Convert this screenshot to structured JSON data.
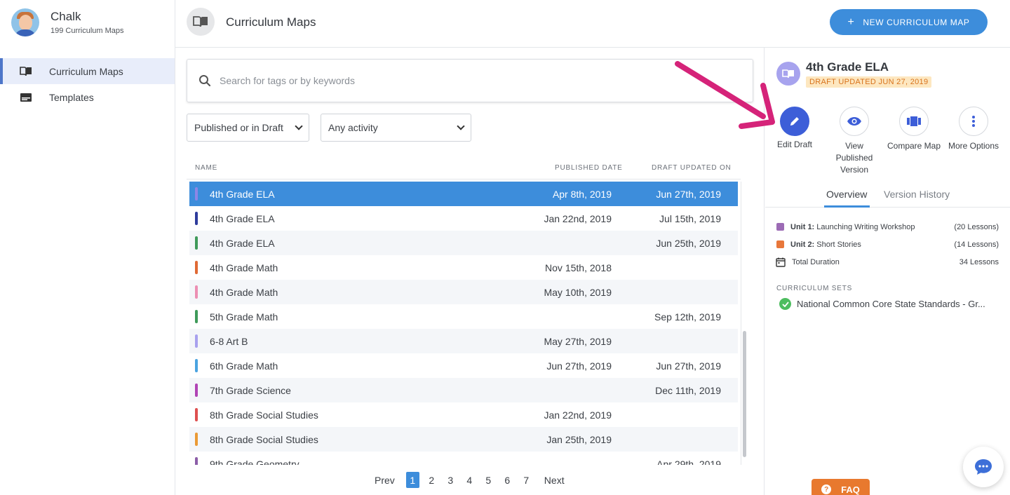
{
  "sidebar": {
    "brand_name": "Chalk",
    "brand_sub": "199 Curriculum Maps",
    "items": [
      {
        "label": "Curriculum Maps",
        "icon": "book-icon"
      },
      {
        "label": "Templates",
        "icon": "template-icon"
      }
    ]
  },
  "header": {
    "title": "Curriculum Maps",
    "new_button": "NEW CURRICULUM MAP"
  },
  "search": {
    "placeholder": "Search for tags or by keywords"
  },
  "filters": {
    "status": "Published or in Draft",
    "activity": "Any activity"
  },
  "table": {
    "col_name": "NAME",
    "col_published": "PUBLISHED DATE",
    "col_draft": "DRAFT UPDATED ON",
    "rows": [
      {
        "name": "4th Grade ELA",
        "published": "Apr 8th, 2019",
        "draft": "Jun 27th, 2019",
        "color": "#8d86e6"
      },
      {
        "name": "4th Grade ELA",
        "published": "Jan 22nd, 2019",
        "draft": "Jul 15th, 2019",
        "color": "#2e3c9c"
      },
      {
        "name": "4th Grade ELA",
        "published": "",
        "draft": "Jun 25th, 2019",
        "color": "#3f9a5a"
      },
      {
        "name": "4th Grade Math",
        "published": "Nov 15th, 2018",
        "draft": "",
        "color": "#e06a35"
      },
      {
        "name": "4th Grade Math",
        "published": "May 10th, 2019",
        "draft": "",
        "color": "#ec8fb3"
      },
      {
        "name": "5th Grade Math",
        "published": "",
        "draft": "Sep 12th, 2019",
        "color": "#3f9a5a"
      },
      {
        "name": "6-8 Art B",
        "published": "May 27th, 2019",
        "draft": "",
        "color": "#a8a1ee"
      },
      {
        "name": "6th Grade Math",
        "published": "Jun 27th, 2019",
        "draft": "Jun 27th, 2019",
        "color": "#4aa3e0"
      },
      {
        "name": "7th Grade Science",
        "published": "",
        "draft": "Dec 11th, 2019",
        "color": "#b044b5"
      },
      {
        "name": "8th Grade Social Studies",
        "published": "Jan 22nd, 2019",
        "draft": "",
        "color": "#de5050"
      },
      {
        "name": "8th Grade Social Studies",
        "published": "Jan 25th, 2019",
        "draft": "",
        "color": "#ea9a35"
      },
      {
        "name": "9th Grade Geometry",
        "published": "",
        "draft": "Apr 29th, 2019",
        "color": "#8c5ea8"
      }
    ]
  },
  "pager": {
    "prev": "Prev",
    "next": "Next",
    "pages": [
      "1",
      "2",
      "3",
      "4",
      "5",
      "6",
      "7"
    ],
    "current": "1"
  },
  "panel": {
    "title": "4th Grade ELA",
    "badge": "DRAFT UPDATED JUN 27, 2019",
    "actions": {
      "edit": "Edit Draft",
      "view_line1": "View",
      "view_line2": "Published",
      "view_line3": "Version",
      "compare": "Compare Map",
      "more": "More Options"
    },
    "tabs": {
      "overview": "Overview",
      "history": "Version History"
    },
    "units": [
      {
        "prefix": "Unit 1:",
        "name": "Launching Writing Workshop",
        "count": "(20 Lessons)",
        "color": "#9c6bb5"
      },
      {
        "prefix": "Unit 2:",
        "name": "Short Stories",
        "count": "(14 Lessons)",
        "color": "#e8773a"
      }
    ],
    "total_label": "Total Duration",
    "total_value": "34 Lessons",
    "sets_label": "CURRICULUM SETS",
    "set_item": "National Common Core State Standards - Gr..."
  },
  "faq": "FAQ"
}
